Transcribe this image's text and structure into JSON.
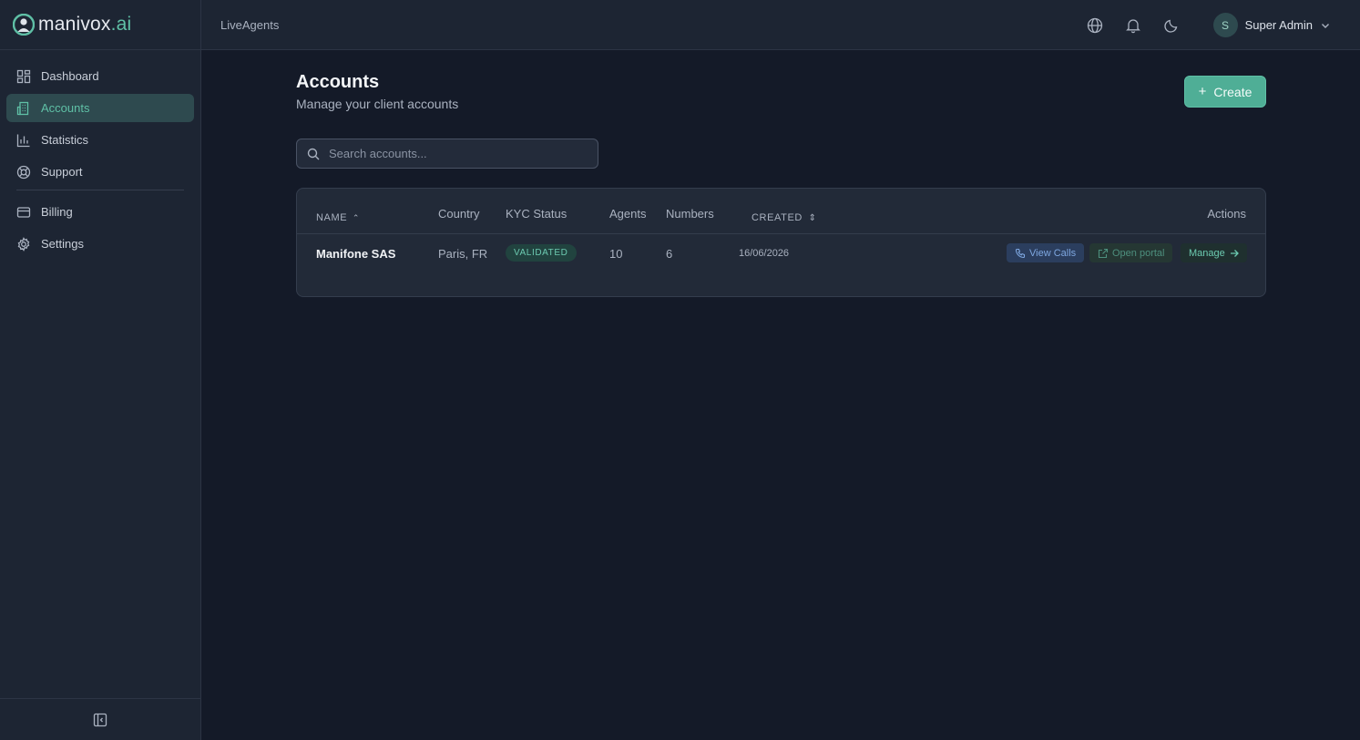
{
  "brand": {
    "name_main": "manivox",
    "name_suffix": ".ai"
  },
  "sidebar": {
    "items": [
      {
        "label": "Dashboard",
        "icon": "dashboard-icon",
        "active": false
      },
      {
        "label": "Accounts",
        "icon": "building-icon",
        "active": true
      },
      {
        "label": "Statistics",
        "icon": "bar-chart-icon",
        "active": false
      },
      {
        "label": "Support",
        "icon": "lifebuoy-icon",
        "active": false
      },
      {
        "label": "Billing",
        "icon": "credit-card-icon",
        "active": false
      },
      {
        "label": "Settings",
        "icon": "gear-icon",
        "active": false
      }
    ]
  },
  "topbar": {
    "breadcrumb": "LiveAgents",
    "user": {
      "initial": "S",
      "name": "Super Admin"
    }
  },
  "page": {
    "title": "Accounts",
    "subtitle": "Manage your client accounts",
    "create_label": "Create"
  },
  "search": {
    "placeholder": "Search accounts..."
  },
  "table": {
    "columns": {
      "name": "NAME",
      "country": "Country",
      "kyc": "KYC Status",
      "agents": "Agents",
      "numbers": "Numbers",
      "created": "CREATED",
      "actions": "Actions"
    },
    "rows": [
      {
        "name": "Manifone SAS",
        "country": "Paris, FR",
        "kyc": "VALIDATED",
        "agents": "10",
        "numbers": "6",
        "created": "16/06/2026",
        "actions": {
          "view_calls": "View Calls",
          "open_portal": "Open portal",
          "manage": "Manage"
        }
      }
    ]
  },
  "colors": {
    "accent": "#5fc0a6",
    "background": "#141a28",
    "panel": "#1d2533"
  }
}
